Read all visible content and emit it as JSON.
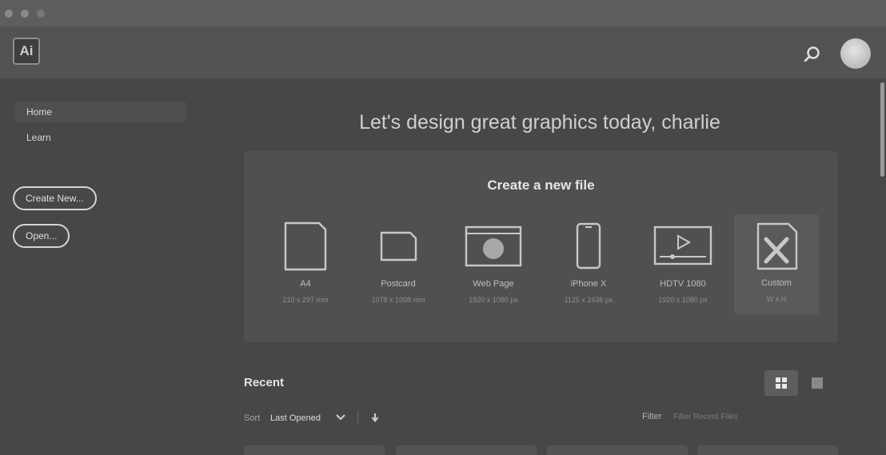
{
  "window": {
    "controls": [
      "close",
      "minimize",
      "zoom"
    ]
  },
  "appbar": {
    "logo_text": "Ai",
    "search_icon": "search-icon",
    "avatar": "user-avatar"
  },
  "sidebar": {
    "nav": [
      {
        "label": "Home",
        "active": true
      },
      {
        "label": "Learn",
        "active": false
      }
    ],
    "create_new_label": "Create New...",
    "open_label": "Open..."
  },
  "main": {
    "greeting": "Let's design great graphics today, charlie",
    "create_title": "Create a new file",
    "presets": [
      {
        "name": "A4",
        "size": "210 x 297 mm",
        "icon": "document-icon"
      },
      {
        "name": "Postcard",
        "size": "1078 x 1008 mm",
        "icon": "postcard-icon"
      },
      {
        "name": "Web Page",
        "size": "1920 x 1080 px",
        "icon": "web-page-icon"
      },
      {
        "name": "iPhone X",
        "size": "1125 x 2436 px",
        "icon": "phone-icon"
      },
      {
        "name": "HDTV 1080",
        "size": "1920 x 1080 px",
        "icon": "video-icon"
      },
      {
        "name": "Custom",
        "size": "W x H",
        "icon": "custom-icon",
        "selected": true
      }
    ],
    "recent_title": "Recent",
    "sort_label": "Sort",
    "sort_value": "Last Opened",
    "filter_label": "Filter",
    "filter_placeholder": "Filter Recent Files"
  },
  "colors": {
    "background": "#474747",
    "panel": "#505050",
    "titlebar": "#5e5e5e",
    "appbar": "#535353"
  }
}
